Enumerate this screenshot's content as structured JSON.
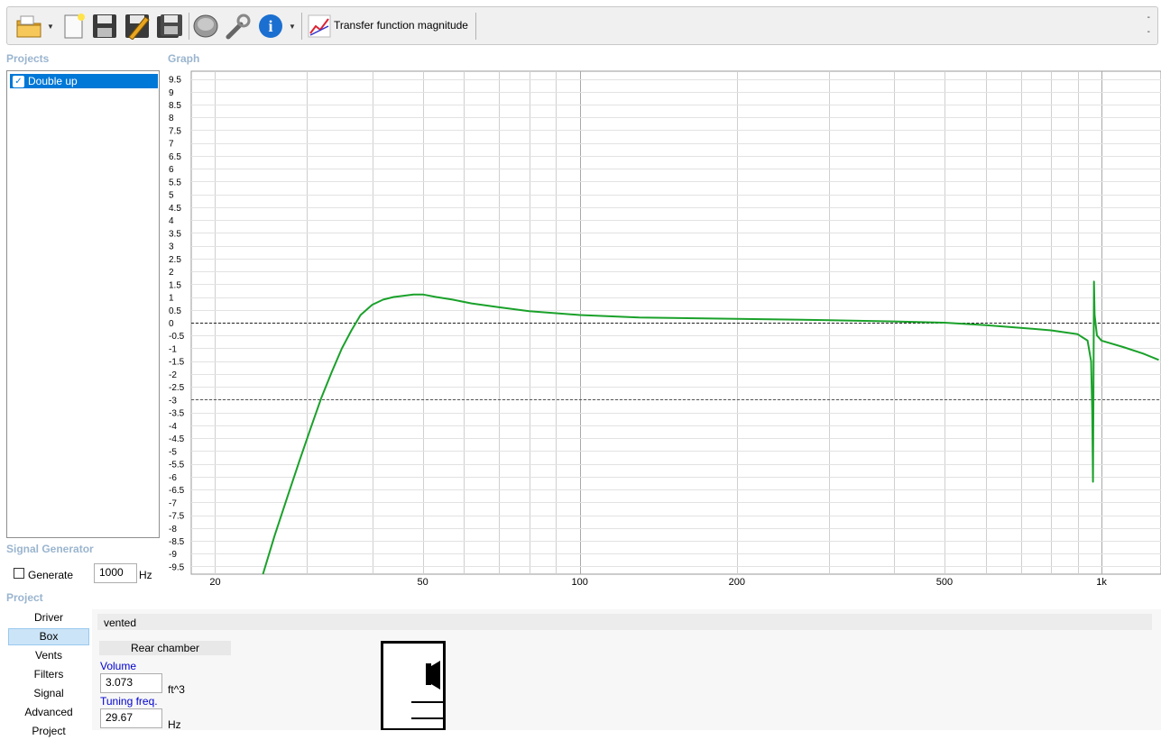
{
  "toolbar": {
    "title": "Transfer function magnitude",
    "icons": [
      "open-folder-icon",
      "new-document-icon",
      "save-icon",
      "save-edit-icon",
      "save-all-icon",
      "speaker-icon",
      "wrench-icon",
      "info-icon",
      "graph-icon"
    ],
    "right_marks": [
      "-",
      "-"
    ]
  },
  "projects": {
    "title": "Projects",
    "items": [
      {
        "label": "Double up",
        "checked": true
      }
    ]
  },
  "graph": {
    "title": "Graph"
  },
  "signal_generator": {
    "title": "Signal Generator",
    "generate_label": "Generate",
    "frequency": "1000",
    "unit": "Hz"
  },
  "project": {
    "title": "Project",
    "nav": [
      "Driver",
      "Box",
      "Vents",
      "Filters",
      "Signal",
      "Advanced",
      "Project"
    ],
    "selected": "Box"
  },
  "box": {
    "type": "vented",
    "chamber_label": "Rear chamber",
    "volume_label": "Volume",
    "volume_value": "3.073",
    "volume_unit": "ft^3",
    "tuning_label": "Tuning freq.",
    "tuning_value": "29.67",
    "tuning_unit": "Hz"
  },
  "colors": {
    "curve": "#1aa12a",
    "selection": "#0078d7",
    "section_title": "#9ab5cf"
  },
  "chart_data": {
    "type": "line",
    "title": "",
    "xlabel": "",
    "ylabel": "",
    "x_scale": "log",
    "xlim": [
      18,
      1300
    ],
    "ylim": [
      -9.8,
      9.8
    ],
    "x_ticks": [
      20,
      50,
      100,
      200,
      500,
      1000
    ],
    "x_tick_labels": [
      "20",
      "50",
      "100",
      "200",
      "500",
      "1k"
    ],
    "y_ticks": [
      9.5,
      9,
      8.5,
      8,
      7.5,
      7,
      6.5,
      6,
      5.5,
      5,
      4.5,
      4,
      3.5,
      3,
      2.5,
      2,
      1.5,
      1,
      0.5,
      0,
      -0.5,
      -1,
      -1.5,
      -2,
      -2.5,
      -3,
      -3.5,
      -4,
      -4.5,
      -5,
      -5.5,
      -6,
      -6.5,
      -7,
      -7.5,
      -8,
      -8.5,
      -9,
      -9.5
    ],
    "y_tick_labels": [
      "9.5",
      "9",
      "8.5",
      "8",
      "7.5",
      "7",
      "6.5",
      "6",
      "5.5",
      "5",
      "4.5",
      "4",
      "3.5",
      "3",
      "2.5",
      "2",
      "1.5",
      "1",
      "0.5",
      "0",
      "-0.5",
      "-1",
      "-1.5",
      "-2",
      "-2.5",
      "-3",
      "-3.5",
      "-4",
      "-4.5",
      "-5",
      "-5.5",
      "-6",
      "-6.5",
      "-7",
      "-7.5",
      "-8",
      "-8.5",
      "-9",
      "-9.5"
    ],
    "reference_lines": [
      0,
      -3
    ],
    "grid": true,
    "series": [
      {
        "x": [
          24.7,
          26,
          27.5,
          29,
          30.5,
          32,
          33.5,
          35,
          36.5,
          38,
          40,
          42,
          44,
          46,
          48,
          50,
          53,
          57,
          62,
          70,
          80,
          100,
          130,
          200,
          300,
          400,
          500,
          600,
          700,
          800,
          900,
          940,
          955,
          960,
          963,
          965,
          967,
          970,
          980,
          1000,
          1100,
          1200,
          1287
        ],
        "y": [
          -9.8,
          -8.3,
          -6.8,
          -5.4,
          -4.1,
          -2.9,
          -1.9,
          -1.0,
          -0.3,
          0.3,
          0.7,
          0.9,
          1.0,
          1.05,
          1.1,
          1.1,
          1.0,
          0.9,
          0.75,
          0.6,
          0.45,
          0.3,
          0.2,
          0.15,
          0.1,
          0.05,
          0.0,
          -0.1,
          -0.2,
          -0.3,
          -0.45,
          -0.7,
          -1.5,
          -3.5,
          -6.2,
          -3.0,
          1.6,
          0.3,
          -0.5,
          -0.7,
          -0.95,
          -1.2,
          -1.45
        ]
      }
    ]
  }
}
